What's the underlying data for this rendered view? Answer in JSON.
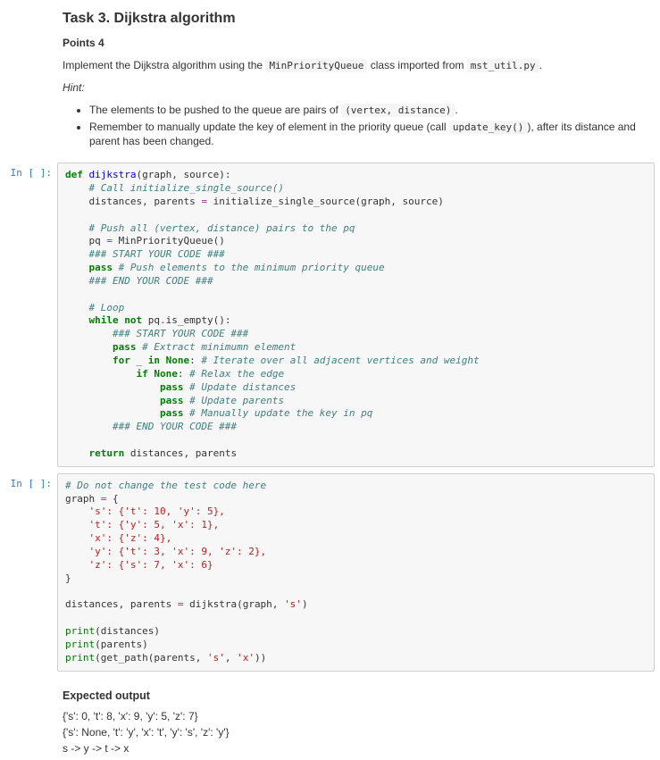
{
  "task": {
    "title": "Task 3. Dijkstra algorithm",
    "points_label": "Points 4",
    "intro_pre": "Implement the Dijkstra algorithm using the ",
    "intro_code1": "MinPriorityQueue",
    "intro_mid": " class imported from ",
    "intro_code2": "mst_util.py",
    "intro_post": ".",
    "hint_label": "Hint:",
    "bullet1_pre": "The elements to be pushed to the queue are pairs of ",
    "bullet1_code": "(vertex, distance)",
    "bullet1_post": ".",
    "bullet2_pre": "Remember to manually update the key of element in the priority queue (call ",
    "bullet2_code": "update_key()",
    "bullet2_post": "), after its distance and parent has been changed."
  },
  "prompt_in": "In [ ]:",
  "code1": {
    "l01_def": "def",
    "l01_fn": " dijkstra",
    "l01_rest": "(graph, source):",
    "l02": "    # Call initialize_single_source()",
    "l03a": "    distances, parents ",
    "l03op": "=",
    "l03b": " initialize_single_source(graph, source)",
    "l04": "",
    "l05": "    # Push all (vertex, distance) pairs to the pq",
    "l06a": "    pq ",
    "l06op": "=",
    "l06b": " MinPriorityQueue()",
    "l07": "    ### START YOUR CODE ###",
    "l08kw": "    pass",
    "l08c": " # Push elements to the minimum priority queue",
    "l09": "    ### END YOUR CODE ###",
    "l10": "",
    "l11": "    # Loop",
    "l12a": "    ",
    "l12kw1": "while",
    "l12b": " ",
    "l12kw2": "not",
    "l12c": " pq",
    "l12op": ".",
    "l12d": "is_empty():",
    "l13": "        ### START YOUR CODE ###",
    "l14kw": "        pass",
    "l14c": " # Extract minimumn element",
    "l15a": "        ",
    "l15kw1": "for",
    "l15b": " _ ",
    "l15kw2": "in",
    "l15c": " ",
    "l15none": "None",
    "l15d": ": ",
    "l15cm": "# Iterate over all adjacent vertices and weight",
    "l16a": "            ",
    "l16kw": "if",
    "l16b": " ",
    "l16none": "None",
    "l16c": ": ",
    "l16cm": "# Relax the edge",
    "l17kw": "                pass",
    "l17c": " # Update distances",
    "l18kw": "                pass",
    "l18c": " # Update parents",
    "l19kw": "                pass",
    "l19c": " # Manually update the key in pq",
    "l20": "        ### END YOUR CODE ###",
    "l21": "",
    "l22a": "    ",
    "l22kw": "return",
    "l22b": " distances, parents"
  },
  "code2": {
    "l01": "# Do not change the test code here",
    "l02a": "graph ",
    "l02op": "=",
    "l02b": " {",
    "l03": "    's': {'t': 10, 'y': 5},",
    "l04": "    't': {'y': 5, 'x': 1},",
    "l05": "    'x': {'z': 4},",
    "l06": "    'y': {'t': 3, 'x': 9, 'z': 2},",
    "l07": "    'z': {'s': 7, 'x': 6}",
    "l08": "}",
    "l09": "",
    "l10a": "distances, parents ",
    "l10op": "=",
    "l10b": " dijkstra(graph, ",
    "l10s": "'s'",
    "l10c": ")",
    "l11": "",
    "l12a": "print",
    "l12b": "(distances)",
    "l13a": "print",
    "l13b": "(parents)",
    "l14a": "print",
    "l14b": "(get_path(parents, ",
    "l14s1": "'s'",
    "l14c": ", ",
    "l14s2": "'x'",
    "l14d": "))"
  },
  "expected": {
    "heading": "Expected output",
    "line1": "{'s': 0, 't': 8, 'x': 9, 'y': 5, 'z': 7}",
    "line2": "{'s': None, 't': 'y', 'x': 't', 'y': 's', 'z': 'y'}",
    "line3": "s -> y -> t -> x"
  }
}
